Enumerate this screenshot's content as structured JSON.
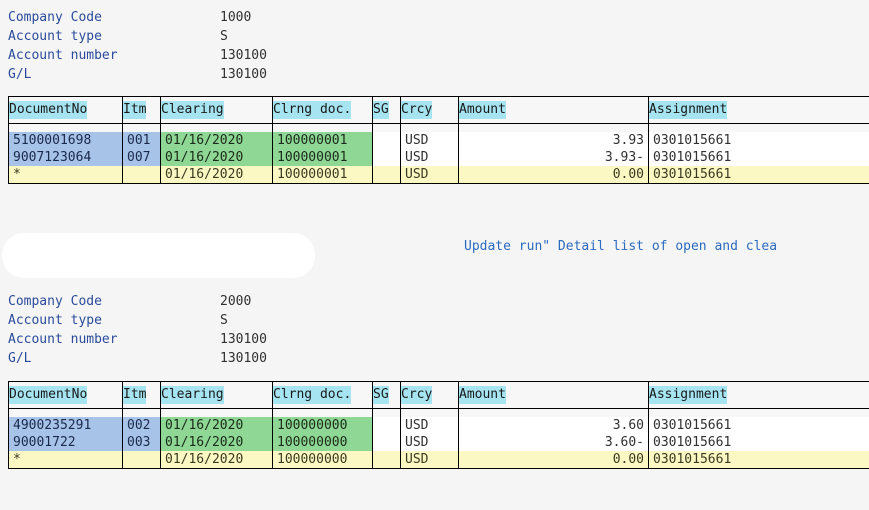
{
  "background_color": "#f5f5f5",
  "colors": {
    "label_blue": "#2a4b9b",
    "header_cyan": "#a6e4f2",
    "highlight_blue": "#a8c3e8",
    "highlight_green": "#8fd794",
    "highlight_yellow": "#fbf8c4",
    "run_title_blue": "#2a6bbf"
  },
  "run_title": "Update run\" Detail list of open and clea",
  "table_columns": [
    "DocumentNo",
    "Itm",
    "Clearing",
    "Clrng doc.",
    "SG",
    "Crcy",
    "Amount",
    "Assignment"
  ],
  "blocks": [
    {
      "header": {
        "rows": [
          {
            "label": "Company Code",
            "value": "1000"
          },
          {
            "label": "Account type",
            "value": "S"
          },
          {
            "label": "Account number",
            "value": "130100"
          },
          {
            "label": "G/L",
            "value": "130100"
          }
        ]
      },
      "rows": [
        {
          "document_no": "5100001698",
          "itm": "001",
          "clearing": "01/16/2020",
          "clrng_doc": "100000001",
          "sg": "",
          "crcy": "USD",
          "amount": "3.93",
          "assignment": "0301015661",
          "style": "detail"
        },
        {
          "document_no": "9007123064",
          "itm": "007",
          "clearing": "01/16/2020",
          "clrng_doc": "100000001",
          "sg": "",
          "crcy": "USD",
          "amount": "3.93-",
          "assignment": "0301015661",
          "style": "detail"
        },
        {
          "document_no": "*",
          "itm": "",
          "clearing": "01/16/2020",
          "clrng_doc": "100000001",
          "sg": "",
          "crcy": "USD",
          "amount": "0.00",
          "assignment": "0301015661",
          "style": "total"
        }
      ]
    },
    {
      "header": {
        "rows": [
          {
            "label": "Company Code",
            "value": "2000"
          },
          {
            "label": "Account type",
            "value": "S"
          },
          {
            "label": "Account number",
            "value": "130100"
          },
          {
            "label": "G/L",
            "value": "130100"
          }
        ]
      },
      "rows": [
        {
          "document_no": "4900235291",
          "itm": "002",
          "clearing": "01/16/2020",
          "clrng_doc": "100000000",
          "sg": "",
          "crcy": "USD",
          "amount": "3.60",
          "assignment": "0301015661",
          "style": "detail"
        },
        {
          "document_no": "90001722",
          "itm": "003",
          "clearing": "01/16/2020",
          "clrng_doc": "100000000",
          "sg": "",
          "crcy": "USD",
          "amount": "3.60-",
          "assignment": "0301015661",
          "style": "detail"
        },
        {
          "document_no": "*",
          "itm": "",
          "clearing": "01/16/2020",
          "clrng_doc": "100000000",
          "sg": "",
          "crcy": "USD",
          "amount": "0.00",
          "assignment": "0301015661",
          "style": "total"
        }
      ]
    }
  ]
}
